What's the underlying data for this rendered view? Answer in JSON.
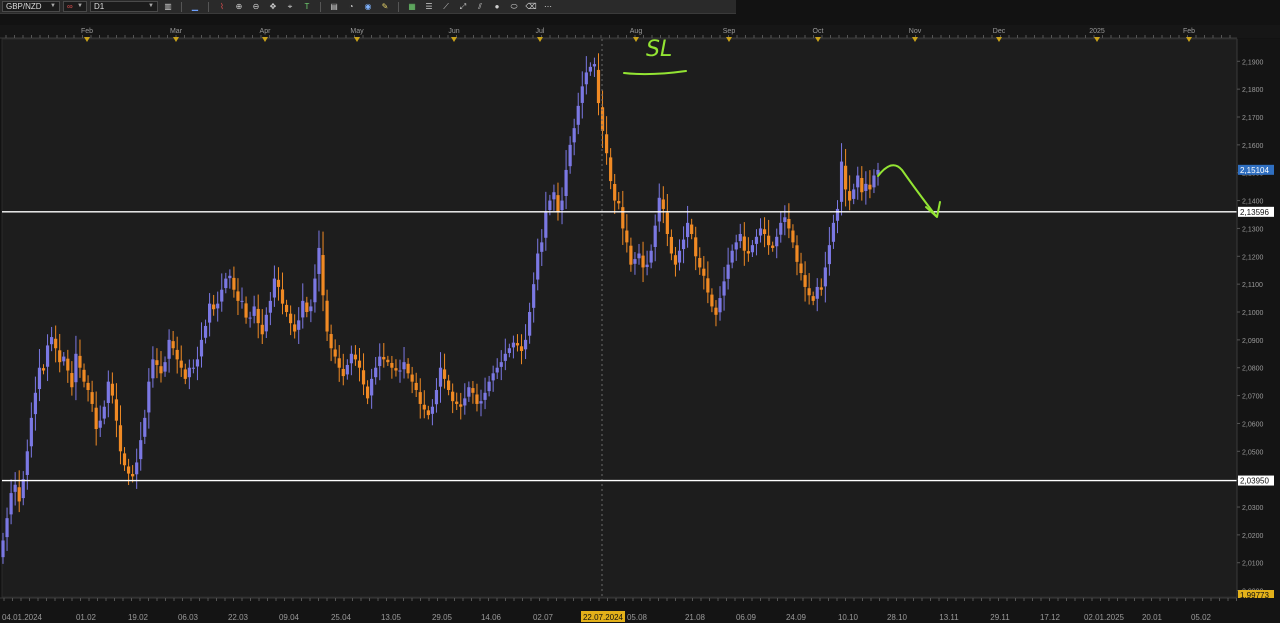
{
  "toolbar": {
    "symbol": "GBP/NZD",
    "timeframe": "D1",
    "chain_icon": "link-icon",
    "icons": [
      "candles-icon",
      "line-tool-icon",
      "trend-icon",
      "zoom-in-icon",
      "zoom-out-icon",
      "crosshair-icon",
      "cursor-icon",
      "text-tool-icon",
      "template-icon",
      "clock-icon",
      "globe-icon",
      "pen-icon",
      "grid-icon",
      "fib-icon",
      "ray-icon",
      "circle-icon",
      "ellipse-icon",
      "eraser-icon",
      "more-icon"
    ]
  },
  "colors": {
    "background": "#121212",
    "plot_background": "#1d1d1d",
    "bull": "#7b78e3",
    "bear": "#f08a24",
    "hline": "#ffffff",
    "annotation": "#93e433",
    "current_price_tag": "#2f6fc1",
    "month_marker": "#c9a21a"
  },
  "month_labels": [
    "Feb",
    "Mar",
    "Apr",
    "May",
    "Jun",
    "Jul",
    "Aug",
    "Sep",
    "Oct",
    "Nov",
    "Dec",
    "2025",
    "Feb"
  ],
  "date_labels": [
    "04.01.2024",
    "01.02",
    "19.02",
    "06.03",
    "22.03",
    "09.04",
    "25.04",
    "13.05",
    "29.05",
    "14.06",
    "02.07",
    "22.07.2024",
    "05.08",
    "21.08",
    "06.09",
    "24.09",
    "10.10",
    "28.10",
    "13.11",
    "29.11",
    "17.12",
    "02.01.2025",
    "20.01",
    "05.02"
  ],
  "crosshair_date": "22.07.2024",
  "price_axis": {
    "ticks": [
      "2,1900",
      "2,1800",
      "2,1700",
      "2,1600",
      "2,1500",
      "2,1400",
      "2,1300",
      "2,1200",
      "2,1100",
      "2,1000",
      "2,0900",
      "2,0800",
      "2,0700",
      "2,0600",
      "2,0500",
      "2,0400",
      "2,0300",
      "2,0200",
      "2,0100",
      "2,0000"
    ],
    "current_price": "2,15104",
    "bottom_price": "1,99773"
  },
  "horizontal_lines": [
    {
      "price": 2.13596,
      "label": "2,13596"
    },
    {
      "price": 2.0395,
      "label": "2,03950"
    }
  ],
  "annotation_text": "SL",
  "chart_data": {
    "type": "candlestick",
    "symbol": "GBP/NZD",
    "timeframe": "D1",
    "x_range": [
      "04.01.2024",
      "05.02.2025"
    ],
    "ylim": [
      1.9977,
      2.198
    ],
    "grid": false,
    "closes": [
      2.018,
      2.026,
      2.035,
      2.038,
      2.032,
      2.04,
      2.05,
      2.062,
      2.071,
      2.08,
      2.079,
      2.088,
      2.091,
      2.087,
      2.082,
      2.084,
      2.079,
      2.073,
      2.085,
      2.08,
      2.075,
      2.072,
      2.067,
      2.058,
      2.061,
      2.066,
      2.075,
      2.07,
      2.061,
      2.05,
      2.045,
      2.042,
      2.041,
      2.046,
      2.054,
      2.062,
      2.075,
      2.083,
      2.081,
      2.078,
      2.082,
      2.09,
      2.087,
      2.083,
      2.08,
      2.076,
      2.08,
      2.08,
      2.083,
      2.09,
      2.095,
      2.103,
      2.101,
      2.103,
      2.108,
      2.112,
      2.113,
      2.108,
      2.104,
      2.104,
      2.098,
      2.098,
      2.102,
      2.096,
      2.092,
      2.099,
      2.104,
      2.112,
      2.109,
      2.103,
      2.1,
      2.096,
      2.093,
      2.097,
      2.104,
      2.1,
      2.102,
      2.112,
      2.123,
      2.106,
      2.093,
      2.087,
      2.084,
      2.08,
      2.077,
      2.081,
      2.085,
      2.083,
      2.08,
      2.074,
      2.069,
      2.076,
      2.08,
      2.084,
      2.083,
      2.082,
      2.08,
      2.079,
      2.079,
      2.082,
      2.078,
      2.075,
      2.072,
      2.067,
      2.065,
      2.063,
      2.066,
      2.072,
      2.08,
      2.076,
      2.072,
      2.068,
      2.067,
      2.066,
      2.069,
      2.073,
      2.071,
      2.067,
      2.068,
      2.071,
      2.075,
      2.078,
      2.08,
      2.082,
      2.085,
      2.087,
      2.089,
      2.088,
      2.086,
      2.09,
      2.1,
      2.11,
      2.121,
      2.125,
      2.136,
      2.14,
      2.143,
      2.136,
      2.14,
      2.151,
      2.16,
      2.166,
      2.174,
      2.181,
      2.186,
      2.188,
      2.189,
      2.175,
      2.165,
      2.157,
      2.147,
      2.14,
      2.139,
      2.13,
      2.125,
      2.117,
      2.119,
      2.121,
      2.116,
      2.117,
      2.122,
      2.131,
      2.141,
      2.137,
      2.128,
      2.121,
      2.117,
      2.122,
      2.126,
      2.132,
      2.128,
      2.12,
      2.116,
      2.113,
      2.107,
      2.102,
      2.099,
      2.105,
      2.111,
      2.117,
      2.122,
      2.125,
      2.128,
      2.122,
      2.121,
      2.124,
      2.127,
      2.13,
      2.128,
      2.124,
      2.123,
      2.127,
      2.132,
      2.134,
      2.13,
      2.125,
      2.118,
      2.114,
      2.109,
      2.106,
      2.104,
      2.109,
      2.108,
      2.116,
      2.124,
      2.132,
      2.137,
      2.154,
      2.144,
      2.14,
      2.144,
      2.149,
      2.143,
      2.146,
      2.144,
      2.149,
      2.151
    ]
  }
}
